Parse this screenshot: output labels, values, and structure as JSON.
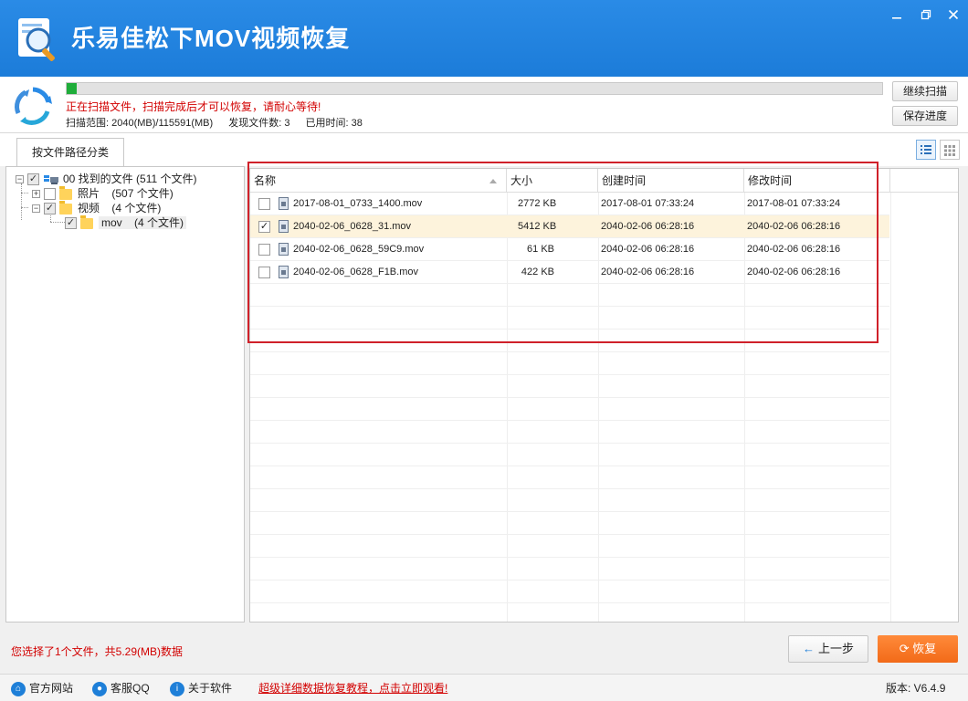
{
  "window": {
    "title": "乐易佳松下MOV视频恢复",
    "controls": [
      "minimize-icon",
      "restore-icon",
      "close-icon"
    ]
  },
  "scan": {
    "progress_fraction": 0.012,
    "status_text": "正在扫描文件，扫描完成后才可以恢复，请耐心等待!",
    "range_text": "扫描范围: 2040(MB)/115591(MB)",
    "found_text": "发现文件数: 3",
    "elapsed_text": "已用时间: 38",
    "continue_button": "继续扫描",
    "save_button": "保存进度"
  },
  "tabs": {
    "active_tab": "按文件路径分类"
  },
  "tree": {
    "root": {
      "label": "00 找到的文件",
      "count": "(511 个文件)"
    },
    "children": [
      {
        "label": "照片",
        "count": "(507 个文件)"
      },
      {
        "label": "视频",
        "count": "(4 个文件)"
      }
    ],
    "grandchild": {
      "label": "mov",
      "count": "(4 个文件)"
    }
  },
  "table": {
    "columns": [
      "名称",
      "大小",
      "创建时间",
      "修改时间"
    ],
    "rows": [
      {
        "checked": false,
        "name": "2017-08-01_0733_1400.mov",
        "size": "2772 KB",
        "created": "2017-08-01  07:33:24",
        "modified": "2017-08-01  07:33:24"
      },
      {
        "checked": true,
        "name": "2040-02-06_0628_31.mov",
        "size": "5412 KB",
        "created": "2040-02-06  06:28:16",
        "modified": "2040-02-06  06:28:16"
      },
      {
        "checked": false,
        "name": "2040-02-06_0628_59C9.mov",
        "size": "61 KB",
        "created": "2040-02-06  06:28:16",
        "modified": "2040-02-06  06:28:16"
      },
      {
        "checked": false,
        "name": "2040-02-06_0628_F1B.mov",
        "size": "422 KB",
        "created": "2040-02-06  06:28:16",
        "modified": "2040-02-06  06:28:16"
      }
    ]
  },
  "bottom": {
    "selection_text": "您选择了1个文件，共5.29(MB)数据",
    "prev_button": "上一步",
    "recover_button": "恢复"
  },
  "footer": {
    "website": "官方网站",
    "support": "客服QQ",
    "about": "关于软件",
    "promo": "超级详细数据恢复教程，点击立即观看!",
    "version": "版本: V6.4.9"
  },
  "colors": {
    "titlebar": "#1c7cd9",
    "progress": "#1fad3a",
    "warning_text": "#d20000",
    "recover_button": "#f26a18",
    "highlight_box": "#d0212a"
  }
}
